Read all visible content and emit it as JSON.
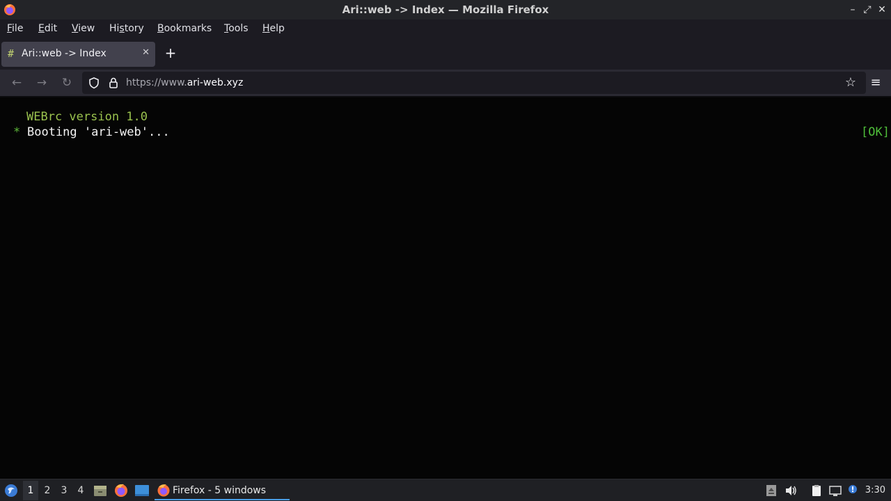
{
  "window": {
    "title": "Ari::web -> Index — Mozilla Firefox",
    "controls": {
      "minimize": "–",
      "restore": "⤢",
      "close": "✕"
    }
  },
  "menubar": {
    "items": [
      {
        "label": "File",
        "accel": "F",
        "rest": "ile"
      },
      {
        "label": "Edit",
        "accel": "E",
        "rest": "dit"
      },
      {
        "label": "View",
        "accel": "V",
        "rest": "iew"
      },
      {
        "label": "History",
        "pre": "Hi",
        "accel": "s",
        "rest": "tory"
      },
      {
        "label": "Bookmarks",
        "accel": "B",
        "rest": "ookmarks"
      },
      {
        "label": "Tools",
        "accel": "T",
        "rest": "ools"
      },
      {
        "label": "Help",
        "accel": "H",
        "rest": "elp"
      }
    ]
  },
  "tabs": [
    {
      "title": "Ari::web -> Index",
      "icon": "#",
      "close": "✕"
    }
  ],
  "new_tab": "+",
  "nav": {
    "back": "←",
    "forward": "→",
    "reload": "↻",
    "url_prefix": "https://www.",
    "url_domain": "ari-web.xyz",
    "bookmark_star": "☆",
    "app_menu": "≡"
  },
  "terminal": {
    "line1": "WEBrc version 1.0",
    "bullet": "*",
    "line2": "Booting 'ari-web'...",
    "status": "[OK]"
  },
  "taskbar": {
    "workspaces": [
      "1",
      "2",
      "3",
      "4"
    ],
    "active_workspace": "1",
    "task_label": "Firefox - 5 windows",
    "clock": "3:30"
  },
  "colors": {
    "terminal_green": "#9ac24e",
    "ok_green": "#4fbf3a",
    "taskbar_accent": "#4a9ee6"
  }
}
